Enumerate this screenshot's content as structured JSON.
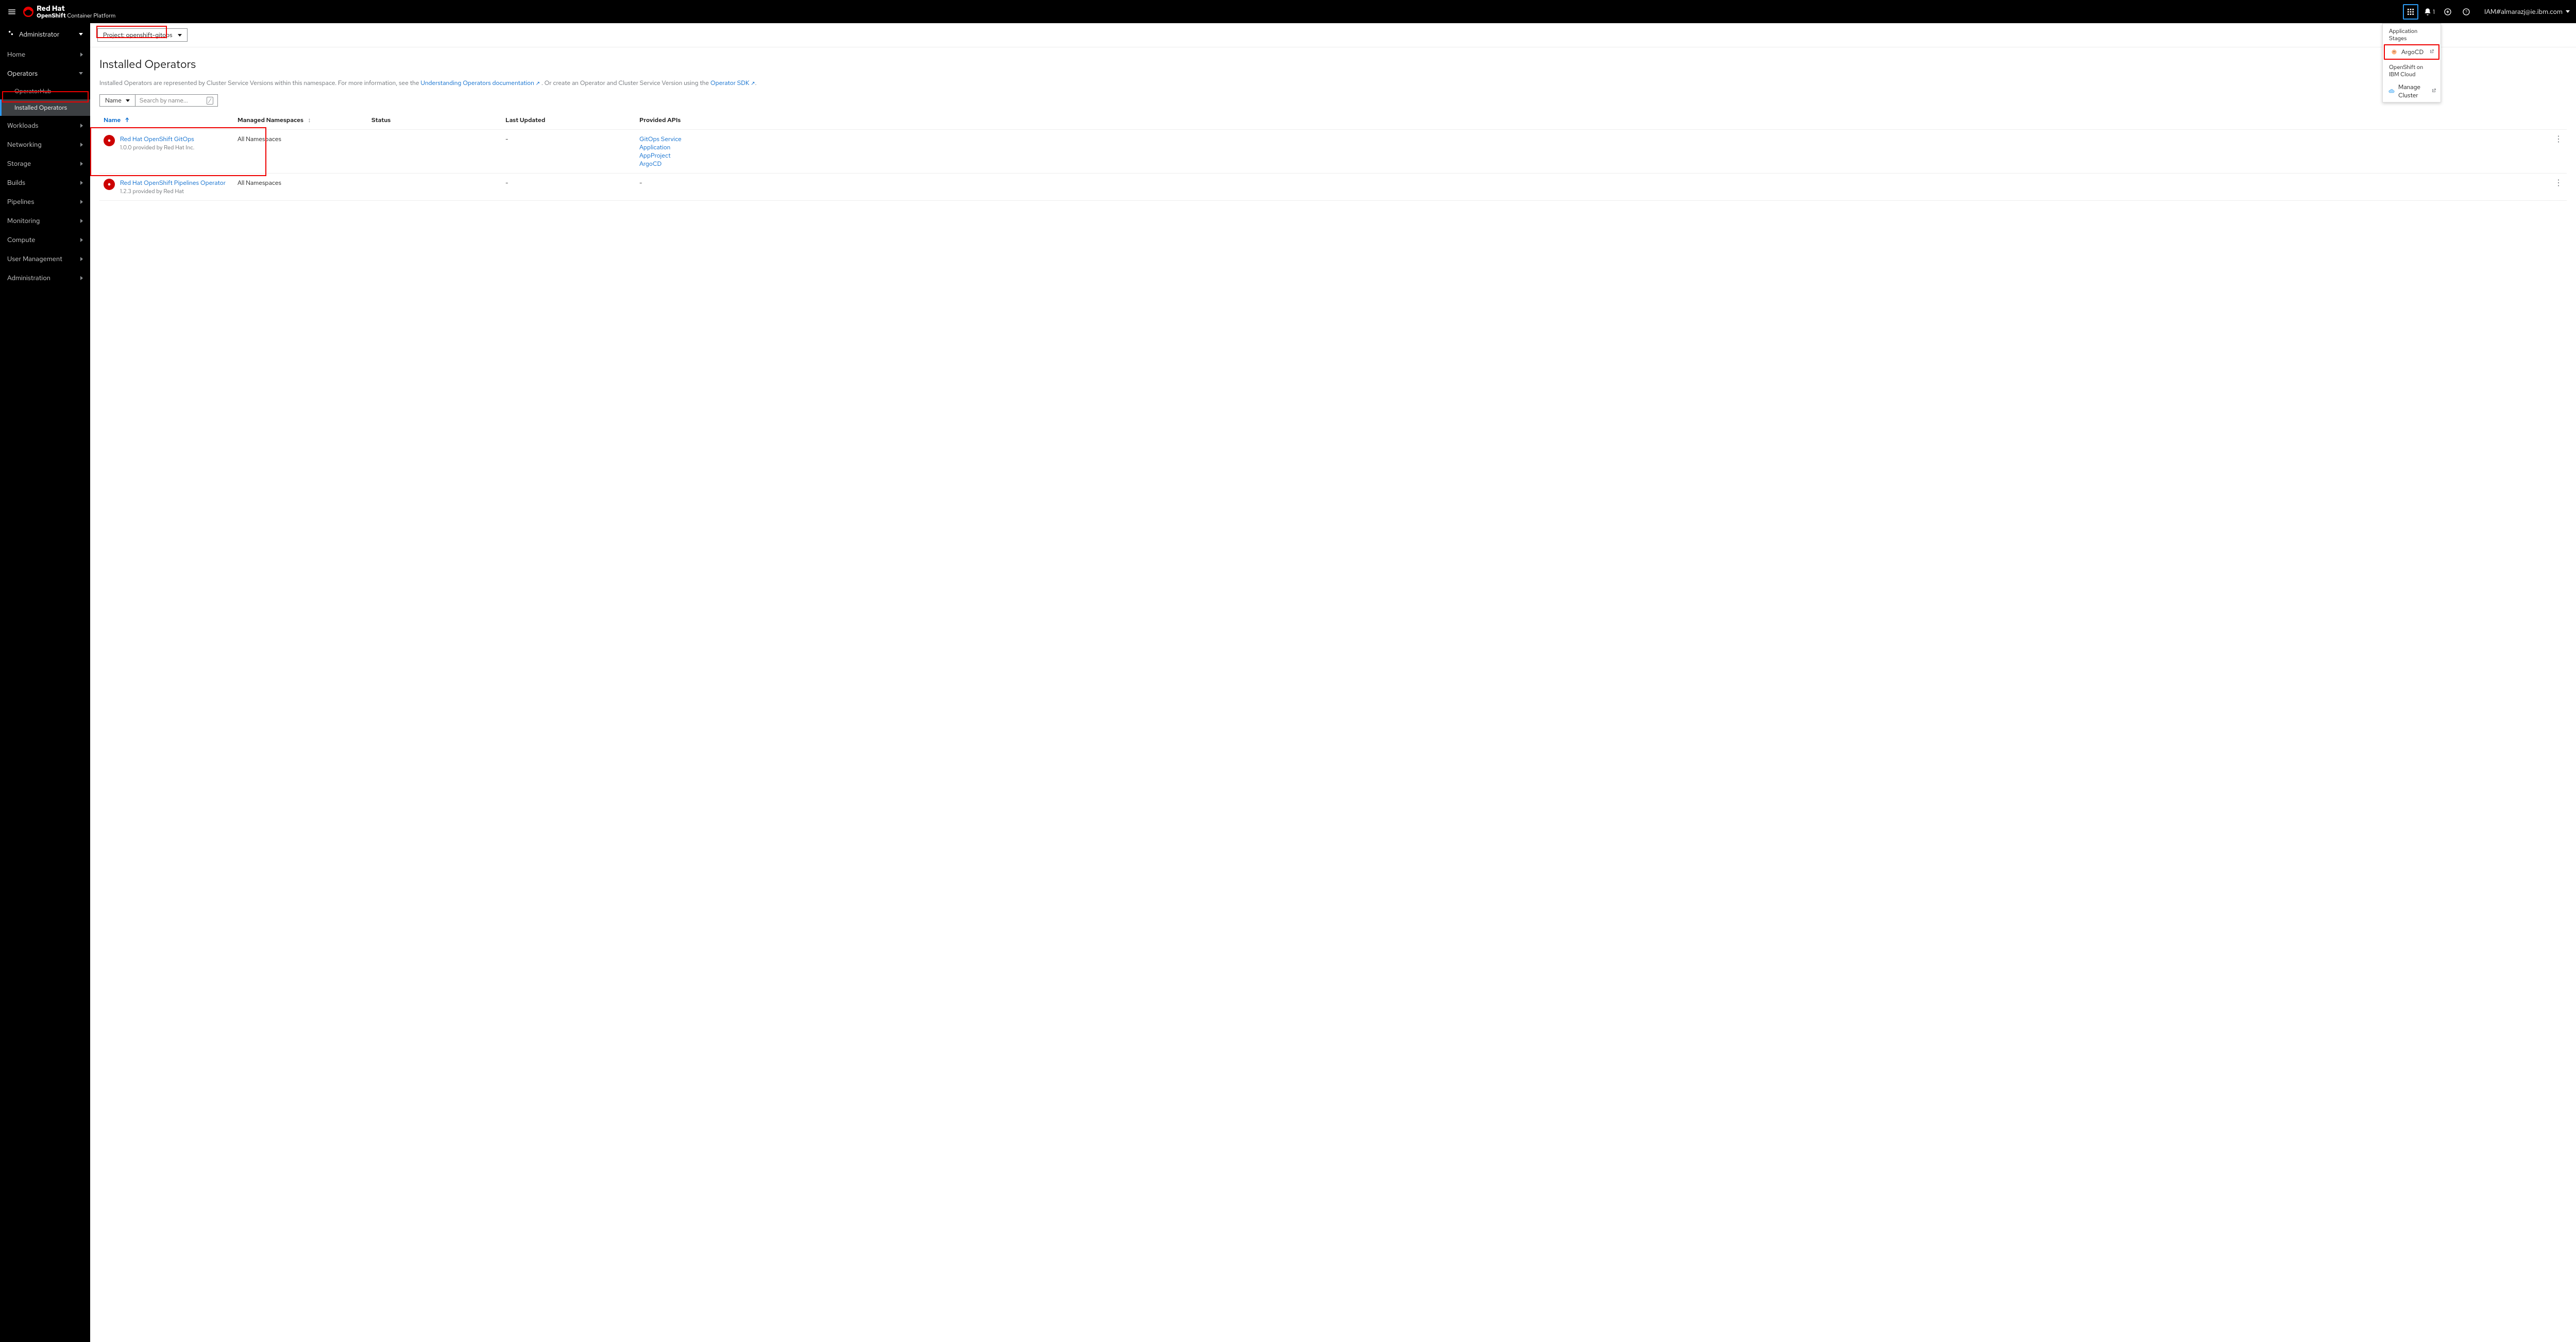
{
  "masthead": {
    "brand_top": "Red Hat",
    "brand_bottom_bold": "OpenShift",
    "brand_bottom_rest": " Container Platform",
    "notification_count": "1",
    "user": "IAM#almarazj@ie.ibm.com"
  },
  "launcher": {
    "group1_title": "Application Stages",
    "group1_item1": "ArgoCD",
    "group2_title": "OpenShift on IBM Cloud",
    "group2_item1": "Manage Cluster"
  },
  "perspective": "Administrator",
  "nav": {
    "home": "Home",
    "operators": "Operators",
    "operatorhub": "OperatorHub",
    "installed": "Installed Operators",
    "workloads": "Workloads",
    "networking": "Networking",
    "storage": "Storage",
    "builds": "Builds",
    "pipelines": "Pipelines",
    "monitoring": "Monitoring",
    "compute": "Compute",
    "usermgmt": "User Management",
    "administration": "Administration"
  },
  "toolbar": {
    "project_label": "Project: openshift-gitops"
  },
  "page": {
    "title": "Installed Operators",
    "desc_pre": "Installed Operators are represented by Cluster Service Versions within this namespace. For more information, see the ",
    "desc_link1": "Understanding Operators documentation",
    "desc_mid": ". Or create an Operator and Cluster Service Version using the ",
    "desc_link2": "Operator SDK",
    "desc_post": "."
  },
  "filter": {
    "by_label": "Name",
    "search_placeholder": "Search by name...",
    "slash": "/"
  },
  "columns": {
    "name": "Name",
    "managed": "Managed Namespaces",
    "status": "Status",
    "updated": "Last Updated",
    "apis": "Provided APIs"
  },
  "rows": [
    {
      "name": "Red Hat OpenShift GitOps",
      "sub": "1.0.0 provided by Red Hat Inc.",
      "managed": "All Namespaces",
      "status": "",
      "updated": "-",
      "apis": [
        "GitOps Service",
        "Application",
        "AppProject",
        "ArgoCD"
      ]
    },
    {
      "name": "Red Hat OpenShift Pipelines Operator",
      "sub": "1.2.3 provided by Red Hat",
      "managed": "All Namespaces",
      "status": "",
      "updated": "-",
      "apis": [
        "-"
      ]
    }
  ]
}
